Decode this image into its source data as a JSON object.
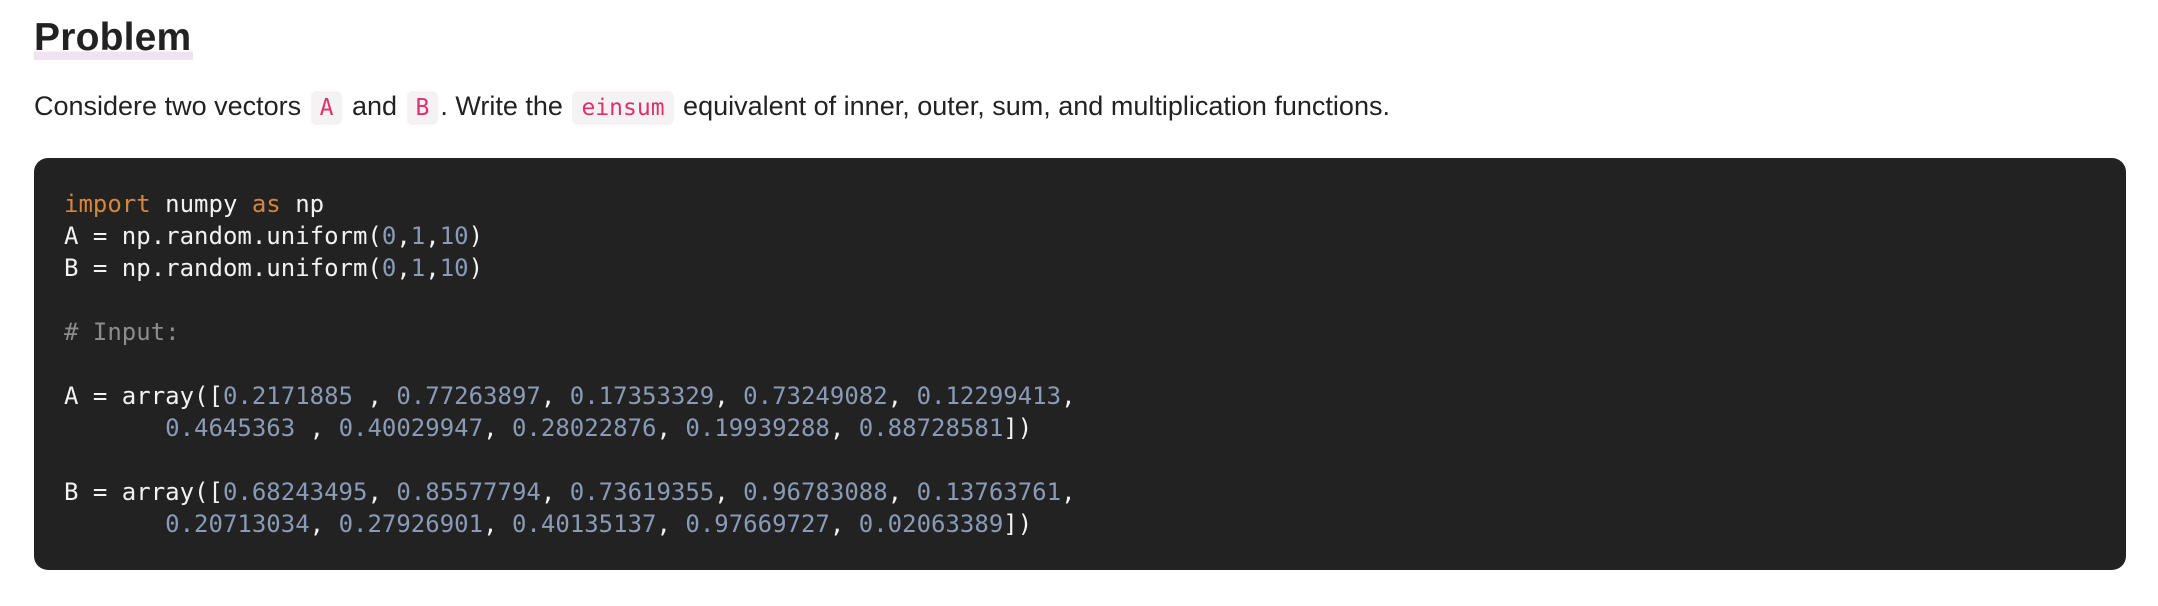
{
  "heading": "Problem",
  "description": {
    "t1": "Considere two vectors ",
    "code_a": "A",
    "t2": " and ",
    "code_b": "B",
    "t3": ". Write the ",
    "code_einsum": "einsum",
    "t4": " equivalent of inner, outer, sum, and multiplication functions."
  },
  "code": {
    "l1_kw_import": "import",
    "l1_module": " numpy ",
    "l1_kw_as": "as",
    "l1_alias": " np",
    "l2_prefix": "A = np.random.uniform(",
    "l2_n0": "0",
    "l2_c1": ",",
    "l2_n1": "1",
    "l2_c2": ",",
    "l2_n2": "10",
    "l2_suffix": ")",
    "l3_prefix": "B = np.random.uniform(",
    "l3_n0": "0",
    "l3_c1": ",",
    "l3_n1": "1",
    "l3_c2": ",",
    "l3_n2": "10",
    "l3_suffix": ")",
    "comment": "# Input:",
    "a1_prefix": "A = array([",
    "a1_v1": "0.2171885 ",
    "a1_v2": "0.77263897",
    "a1_v3": "0.17353329",
    "a1_v4": "0.73249082",
    "a1_v5": "0.12299413",
    "a2_v1": "0.4645363 ",
    "a2_v2": "0.40029947",
    "a2_v3": "0.28022876",
    "a2_v4": "0.19939288",
    "a2_v5": "0.88728581",
    "a2_suffix": "])",
    "b1_prefix": "B = array([",
    "b1_v1": "0.68243495",
    "b1_v2": "0.85577794",
    "b1_v3": "0.73619355",
    "b1_v4": "0.96783088",
    "b1_v5": "0.13763761",
    "b2_v1": "0.20713034",
    "b2_v2": "0.27926901",
    "b2_v3": "0.40135137",
    "b2_v4": "0.97669727",
    "b2_v5": "0.02063389",
    "b2_suffix": "])",
    "sep": ", ",
    "indent": "       "
  }
}
